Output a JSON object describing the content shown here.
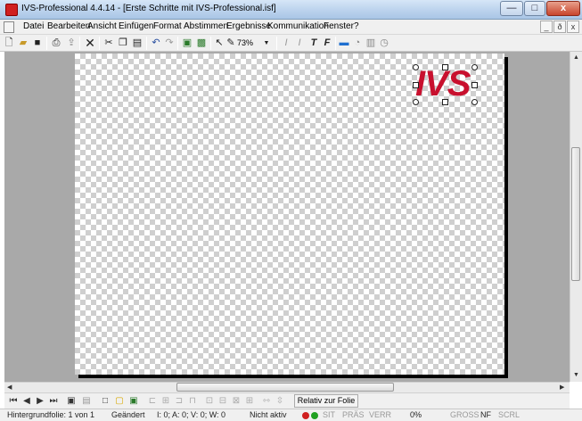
{
  "window": {
    "title": "IVS-Professional 4.4.14 - [Erste Schritte mit IVS-Professional.isf]",
    "minimize": "—",
    "maximize": "□",
    "close": "x"
  },
  "menu": {
    "items": [
      "Datei",
      "Bearbeiten",
      "Ansicht",
      "Einfügen",
      "Format",
      "Abstimmen",
      "Ergebnisse",
      "Kommunikation",
      "Fenster",
      "?"
    ],
    "mdi": [
      "_",
      "ð",
      "x"
    ]
  },
  "toolbar": {
    "zoom": "73%",
    "zoom_caret": "▼"
  },
  "slide": {
    "logo_text": "IVS"
  },
  "navbar": {
    "relative_button": "Relativ zur Folie"
  },
  "status": {
    "background": "Hintergrundfolie: 1 von 1",
    "changed": "Geändert",
    "coords": "I: 0;  A: 0;  V: 0;  W: 0",
    "active": "Nicht aktiv",
    "sit": "SIT",
    "pras": "PRÄS",
    "verr": "VERR",
    "percent": "0%",
    "gross": "GROSS",
    "nf": "NF",
    "scrl": "SCRL"
  }
}
